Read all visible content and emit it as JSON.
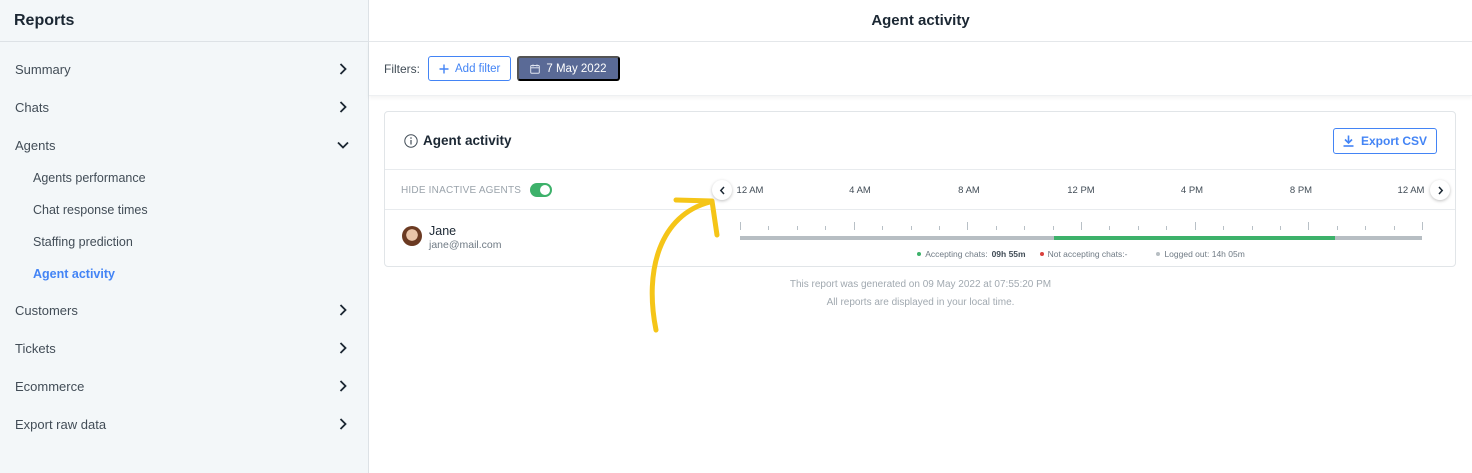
{
  "sidebar": {
    "title": "Reports",
    "items": [
      {
        "label": "Summary",
        "chevron": "right"
      },
      {
        "label": "Chats",
        "chevron": "right"
      },
      {
        "label": "Agents",
        "chevron": "down"
      },
      {
        "label": "Customers",
        "chevron": "right"
      },
      {
        "label": "Tickets",
        "chevron": "right"
      },
      {
        "label": "Ecommerce",
        "chevron": "right"
      },
      {
        "label": "Export raw data",
        "chevron": "right"
      }
    ],
    "agents_subitems": [
      {
        "label": "Agents performance",
        "active": false
      },
      {
        "label": "Chat response times",
        "active": false
      },
      {
        "label": "Staffing prediction",
        "active": false
      },
      {
        "label": "Agent activity",
        "active": true
      }
    ]
  },
  "header": {
    "title": "Agent activity"
  },
  "filters": {
    "label": "Filters:",
    "add_filter": "Add filter",
    "date": "7 May 2022"
  },
  "card": {
    "title": "Agent activity",
    "export_label": "Export CSV",
    "hide_inactive_label": "HIDE INACTIVE AGENTS",
    "hide_inactive_on": true,
    "time_labels": [
      "12 AM",
      "4 AM",
      "8 AM",
      "12 PM",
      "4 PM",
      "8 PM",
      "12 AM"
    ],
    "agent": {
      "name": "Jane",
      "email": "jane@mail.com"
    },
    "activity": {
      "accepting_start_fraction": 0.46,
      "accepting_end_fraction": 0.873
    },
    "legend": {
      "accepting_label": "Accepting chats:",
      "accepting_value": "09h 55m",
      "not_accepting_label": "Not accepting chats:-",
      "logged_out_label": "Logged out: 14h 05m"
    }
  },
  "footer": {
    "line1": "This report was generated on 09 May 2022 at 07:55:20 PM",
    "line2": "All reports are displayed in your local time."
  },
  "colors": {
    "accent": "#4384f5",
    "date_button": "#5a6a96",
    "accepting": "#3db16a",
    "not_accepting": "#d9413d",
    "logged_out": "#b7bec3",
    "annotation": "#f5c518"
  }
}
